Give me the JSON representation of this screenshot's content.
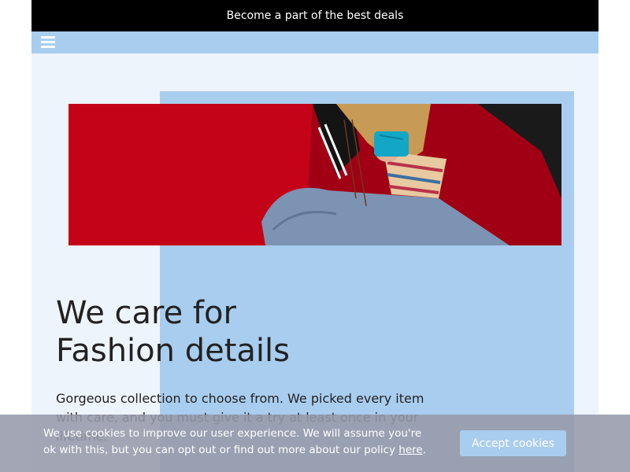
{
  "announcement": {
    "text": "Become a part of the best deals"
  },
  "nav": {
    "menu_icon": "hamburger-menu-icon"
  },
  "hero": {
    "image_description": "woman in red jacket holding blue phone",
    "headline_line1": "We care for",
    "headline_line2": "Fashion details",
    "description": "Gorgeous collection to choose from. We picked every item with care, and you must give it a try at least once in your lifetime."
  },
  "cookie": {
    "text_before_link": "We use cookies to improve our user experience. We will assume you're ok with this, but you can opt out or find out more about our policy ",
    "link_text": "here",
    "text_after_link": ".",
    "accept_label": "Accept cookies"
  },
  "colors": {
    "topbar_bg": "#000000",
    "nav_bg": "#a9cdee",
    "page_bg": "#eef4fb",
    "accent_block": "#a9cdee",
    "hero_red": "#c40319",
    "cookie_bg": "#969aaa"
  }
}
